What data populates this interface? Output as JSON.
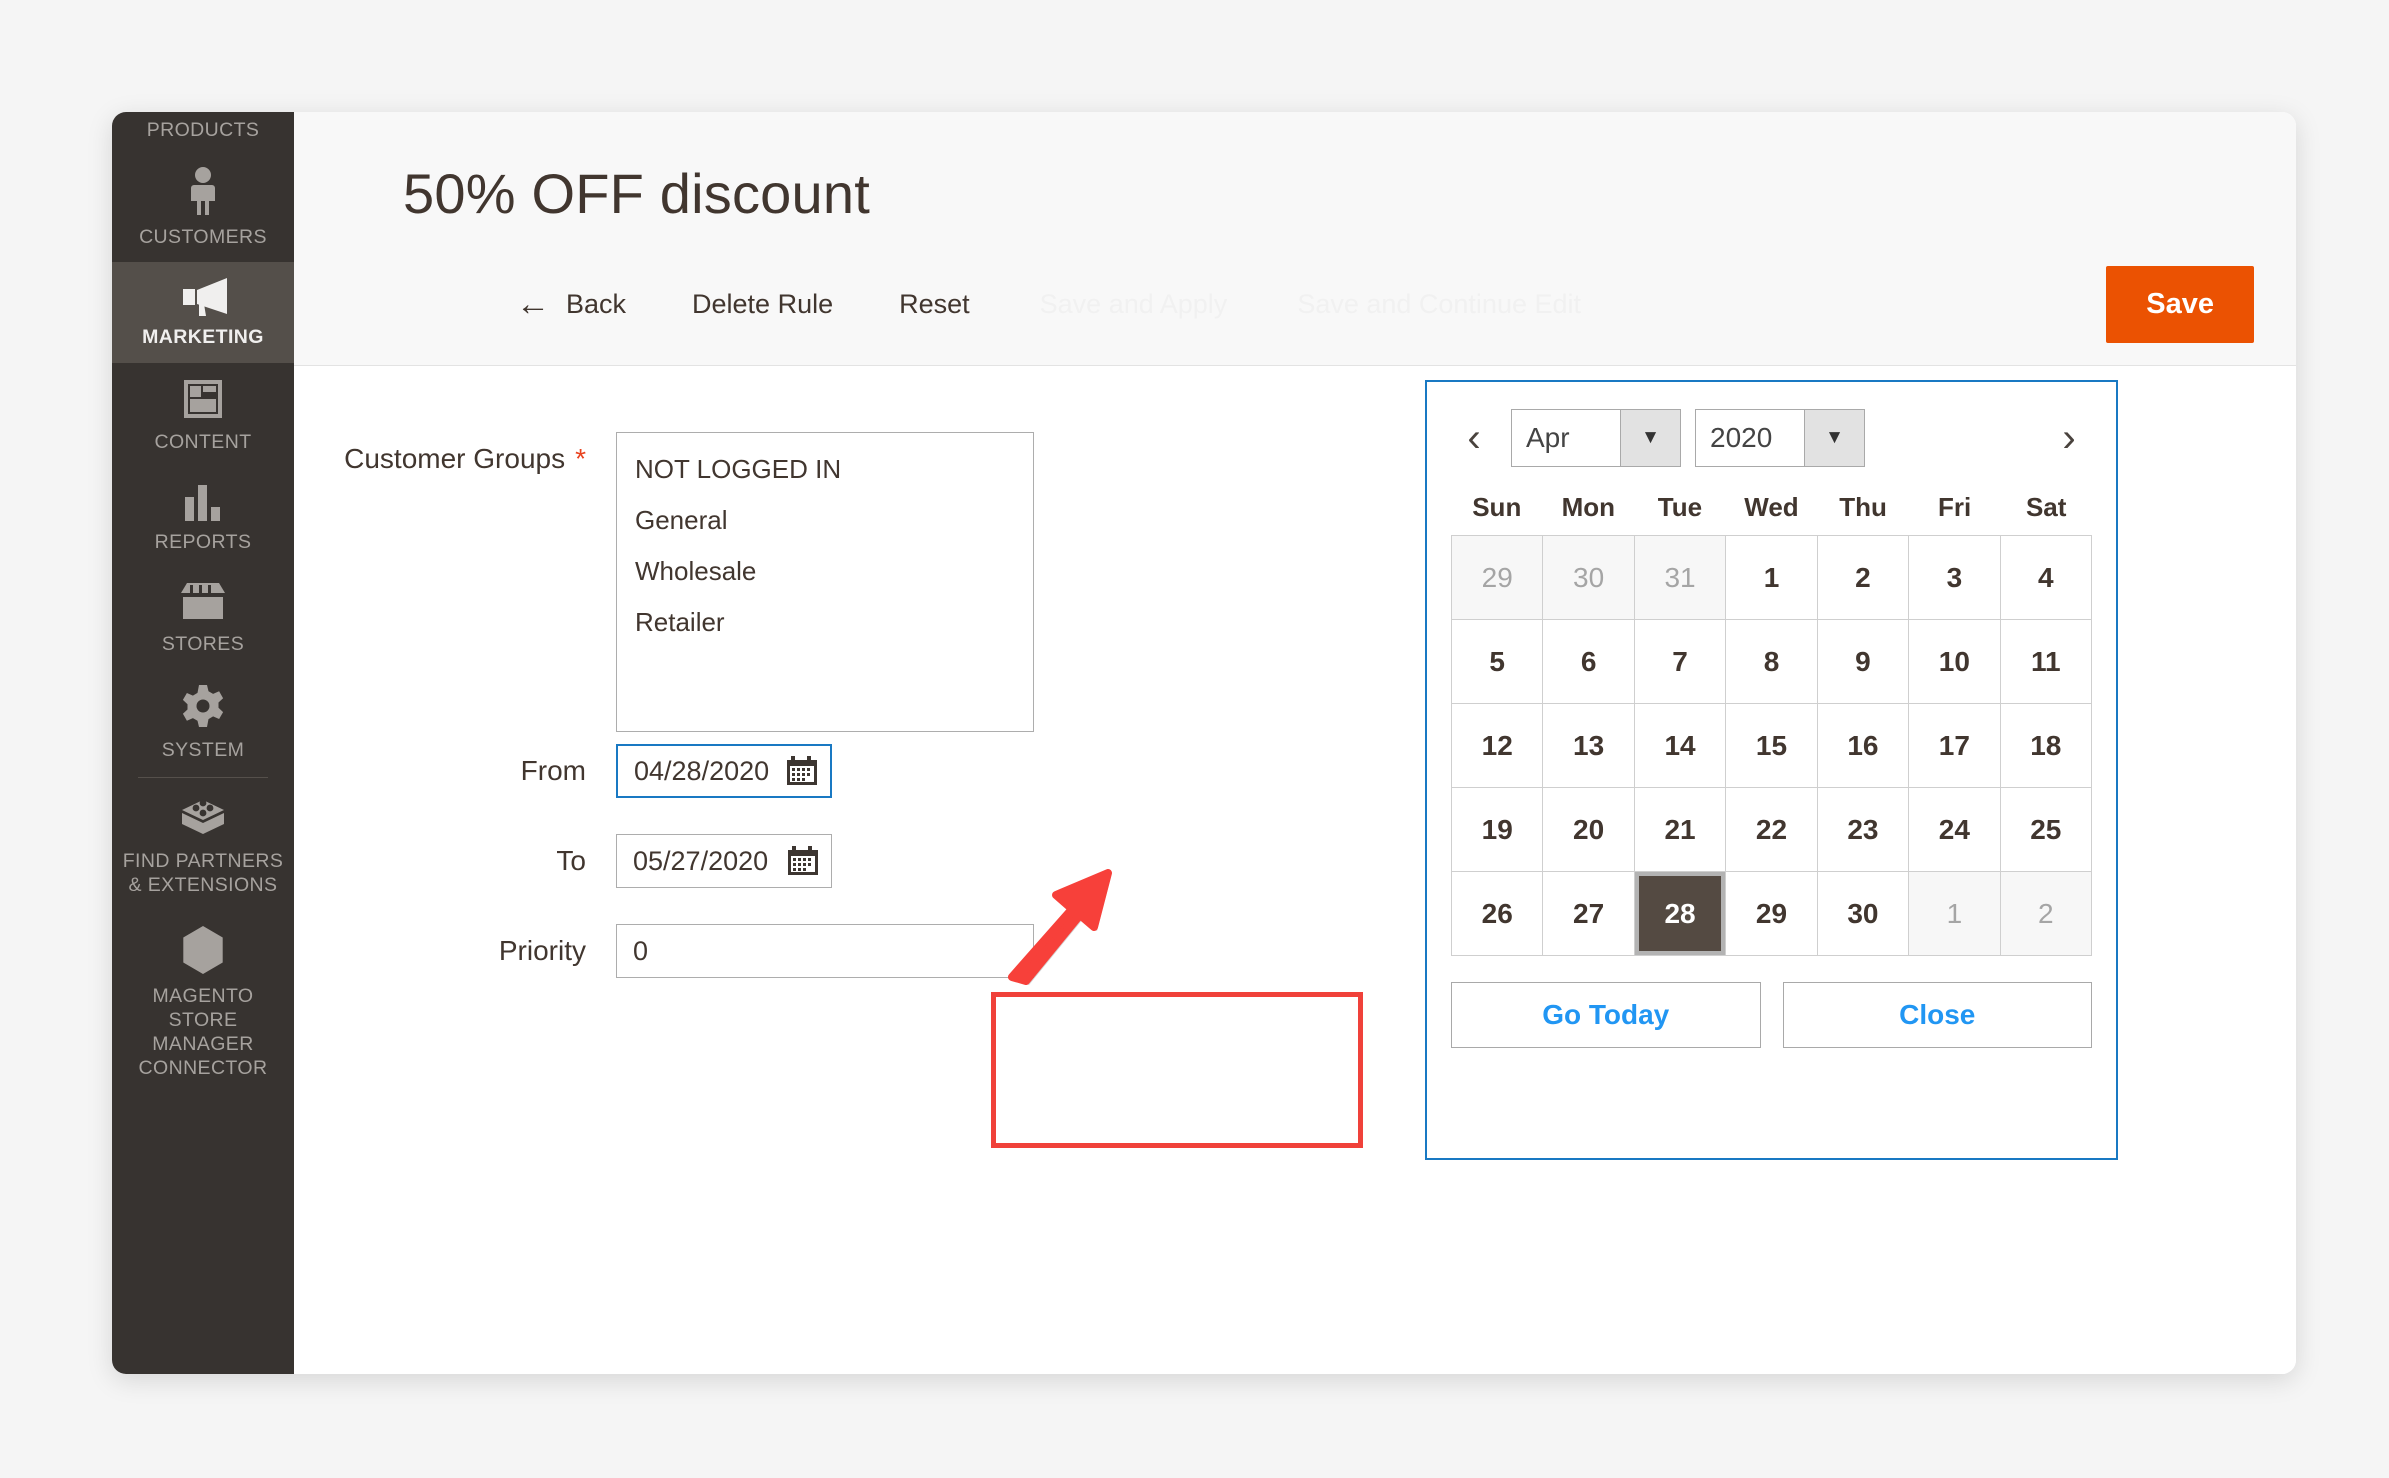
{
  "sidebar": {
    "items": [
      {
        "label": "PRODUCTS",
        "icon": "box-icon",
        "partial": true,
        "active": false
      },
      {
        "label": "CUSTOMERS",
        "icon": "person-icon",
        "partial": false,
        "active": false
      },
      {
        "label": "MARKETING",
        "icon": "megaphone-icon",
        "partial": false,
        "active": true
      },
      {
        "label": "CONTENT",
        "icon": "layout-icon",
        "partial": false,
        "active": false
      },
      {
        "label": "REPORTS",
        "icon": "bar-chart-icon",
        "partial": false,
        "active": false
      },
      {
        "label": "STORES",
        "icon": "storefront-icon",
        "partial": false,
        "active": false
      },
      {
        "label": "SYSTEM",
        "icon": "gear-icon",
        "partial": false,
        "active": false
      },
      {
        "label": "FIND PARTNERS\n& EXTENSIONS",
        "icon": "puzzle-block-icon",
        "partial": false,
        "active": false
      },
      {
        "label": "MAGENTO\nSTORE\nMANAGER\nCONNECTOR",
        "icon": "hexagon-icon",
        "partial": false,
        "active": false
      }
    ]
  },
  "header": {
    "title": "50% OFF discount",
    "back_label": "Back",
    "back_arrow": "←",
    "delete_label": "Delete Rule",
    "reset_label": "Reset",
    "save_apply_label": "Save and Apply",
    "save_continue_label": "Save and Continue Edit",
    "save_label": "Save",
    "save_color": "#eb5202"
  },
  "form": {
    "customer_groups": {
      "label": "Customer Groups",
      "required_marker": "*",
      "options": [
        "NOT LOGGED IN",
        "General",
        "Wholesale",
        "Retailer"
      ]
    },
    "from": {
      "label": "From",
      "value": "04/28/2020",
      "icon": "calendar-icon"
    },
    "to": {
      "label": "To",
      "value": "05/27/2020",
      "icon": "calendar-icon"
    },
    "priority": {
      "label": "Priority",
      "value": "0"
    }
  },
  "calendar": {
    "prev_icon": "‹",
    "next_icon": "›",
    "month": "Apr",
    "year": "2020",
    "dropdown_icon": "▼",
    "weekdays": [
      "Sun",
      "Mon",
      "Tue",
      "Wed",
      "Thu",
      "Fri",
      "Sat"
    ],
    "weeks": [
      [
        {
          "d": "29",
          "o": true
        },
        {
          "d": "30",
          "o": true
        },
        {
          "d": "31",
          "o": true
        },
        {
          "d": "1"
        },
        {
          "d": "2"
        },
        {
          "d": "3"
        },
        {
          "d": "4"
        }
      ],
      [
        {
          "d": "5"
        },
        {
          "d": "6"
        },
        {
          "d": "7"
        },
        {
          "d": "8"
        },
        {
          "d": "9"
        },
        {
          "d": "10"
        },
        {
          "d": "11"
        }
      ],
      [
        {
          "d": "12"
        },
        {
          "d": "13"
        },
        {
          "d": "14"
        },
        {
          "d": "15"
        },
        {
          "d": "16"
        },
        {
          "d": "17"
        },
        {
          "d": "18"
        }
      ],
      [
        {
          "d": "19"
        },
        {
          "d": "20"
        },
        {
          "d": "21"
        },
        {
          "d": "22"
        },
        {
          "d": "23"
        },
        {
          "d": "24"
        },
        {
          "d": "25"
        }
      ],
      [
        {
          "d": "26"
        },
        {
          "d": "27"
        },
        {
          "d": "28",
          "sel": true
        },
        {
          "d": "29"
        },
        {
          "d": "30"
        },
        {
          "d": "1",
          "o": true
        },
        {
          "d": "2",
          "o": true
        }
      ]
    ],
    "go_today_label": "Go Today",
    "close_label": "Close",
    "border_color": "#1979c3",
    "link_color": "#2196f3"
  },
  "annotations": {
    "highlight_color": "#f0413a",
    "arrow_color": "#f0413a"
  }
}
